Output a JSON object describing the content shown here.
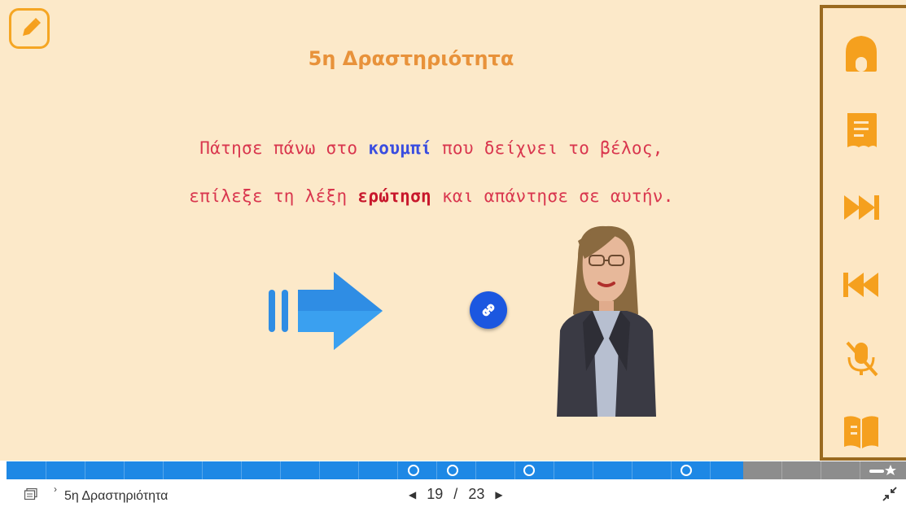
{
  "slide": {
    "title": "5η Δραστηριότητα",
    "instruction_line1": {
      "before": "Πάτησε πάνω στο ",
      "highlight": "κουμπί",
      "after": " που δείχνει το βέλος,"
    },
    "instruction_line2": {
      "before": "επίλεξε τη λέξη ",
      "highlight": "ερώτηση",
      "after": " και απάντησε σε αυτήν."
    }
  },
  "side_nav": {
    "icons": [
      "home-icon",
      "document-icon",
      "next-icon",
      "previous-icon",
      "mute-icon",
      "book-icon"
    ],
    "accent": "#f5a01e",
    "border": "#9a6a20"
  },
  "progress": {
    "current": 19,
    "total": 23,
    "accent": "#1e88e5"
  },
  "bottom_bar": {
    "slide_name": "5η Δραστηριότητα",
    "current_page": "19",
    "separator": "/",
    "total_pages": "23"
  }
}
